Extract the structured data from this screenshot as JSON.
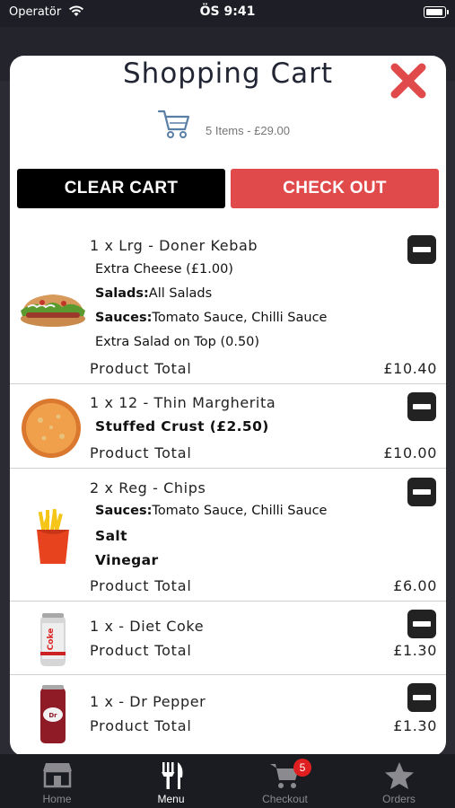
{
  "status_bar": {
    "carrier": "Operatör",
    "time": "ÖS 9:41"
  },
  "cart": {
    "title": "Shopping Cart",
    "summary": "5 Items - £29.00",
    "clear_label": "CLEAR CART",
    "checkout_label": "CHECK OUT",
    "items": [
      {
        "title": "1 x Lrg - Doner Kebab",
        "options": [
          {
            "text": "Extra Cheese (£1.00)"
          },
          {
            "label": "Salads:",
            "value": "All Salads"
          },
          {
            "label": "Sauces:",
            "value": "Tomato Sauce, Chilli Sauce"
          },
          {
            "text": "Extra Salad on Top (0.50)"
          }
        ],
        "total_label": "Product Total",
        "total": "£10.40",
        "image": "doner-kebab"
      },
      {
        "title": "1 x 12 - Thin Margherita",
        "options": [
          {
            "text": "Stuffed Crust (£2.50)"
          }
        ],
        "total_label": "Product Total",
        "total": "£10.00",
        "image": "pizza"
      },
      {
        "title": "2 x Reg - Chips",
        "options": [
          {
            "label": "Sauces:",
            "value": "Tomato Sauce, Chilli Sauce"
          },
          {
            "text": "Salt"
          },
          {
            "text": "Vinegar"
          }
        ],
        "total_label": "Product Total",
        "total": "£6.00",
        "image": "chips"
      },
      {
        "title": "1 x - Diet Coke",
        "options": [],
        "total_label": "Product Total",
        "total": "£1.30",
        "image": "diet-coke-can"
      },
      {
        "title": "1 x - Dr Pepper",
        "options": [],
        "total_label": "Product Total",
        "total": "£1.30",
        "image": "dr-pepper-can"
      }
    ]
  },
  "tabbar": {
    "tabs": [
      {
        "label": "Home",
        "icon": "store-icon",
        "active": false
      },
      {
        "label": "Menu",
        "icon": "cutlery-icon",
        "active": true
      },
      {
        "label": "Checkout",
        "icon": "cart-icon",
        "active": false,
        "badge": "5"
      },
      {
        "label": "Orders",
        "icon": "star-icon",
        "active": false
      }
    ]
  },
  "colors": {
    "checkout_red": "#e04a4a",
    "close_red": "#e04a4a",
    "tab_active": "#ffffff",
    "tab_inactive": "#8a8a8f"
  }
}
